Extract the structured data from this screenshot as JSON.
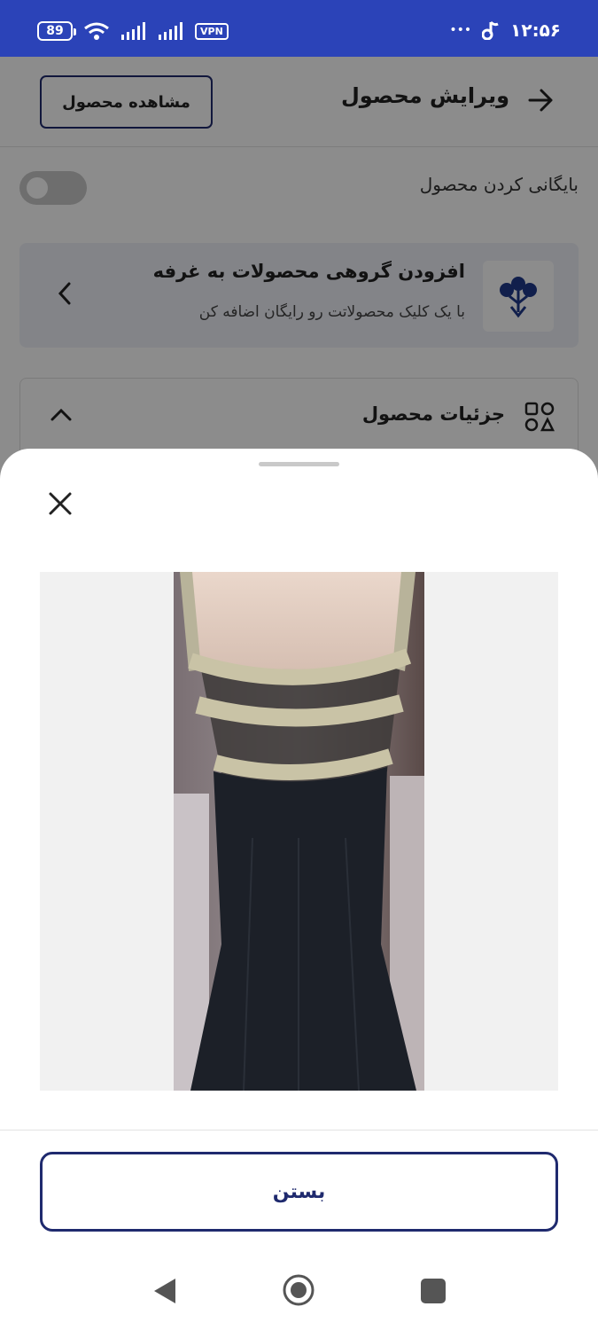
{
  "status_bar": {
    "time": "۱۲:۵۶",
    "battery": "89",
    "vpn": "VPN",
    "dots": "•••"
  },
  "header": {
    "title": "ویرایش محصول",
    "view_button": "مشاهده محصول"
  },
  "archive": {
    "label": "بایگانی کردن محصول"
  },
  "promo": {
    "title": "افزودن گروهی محصولات به غرفه",
    "subtitle": "با یک کلیک محصولاتت رو رایگان اضافه کن"
  },
  "details": {
    "title": "جزئیات محصول"
  },
  "sheet": {
    "close_button": "بستن"
  },
  "colors": {
    "status_bar": "#2b43b8",
    "accent": "#1f2a6e"
  }
}
